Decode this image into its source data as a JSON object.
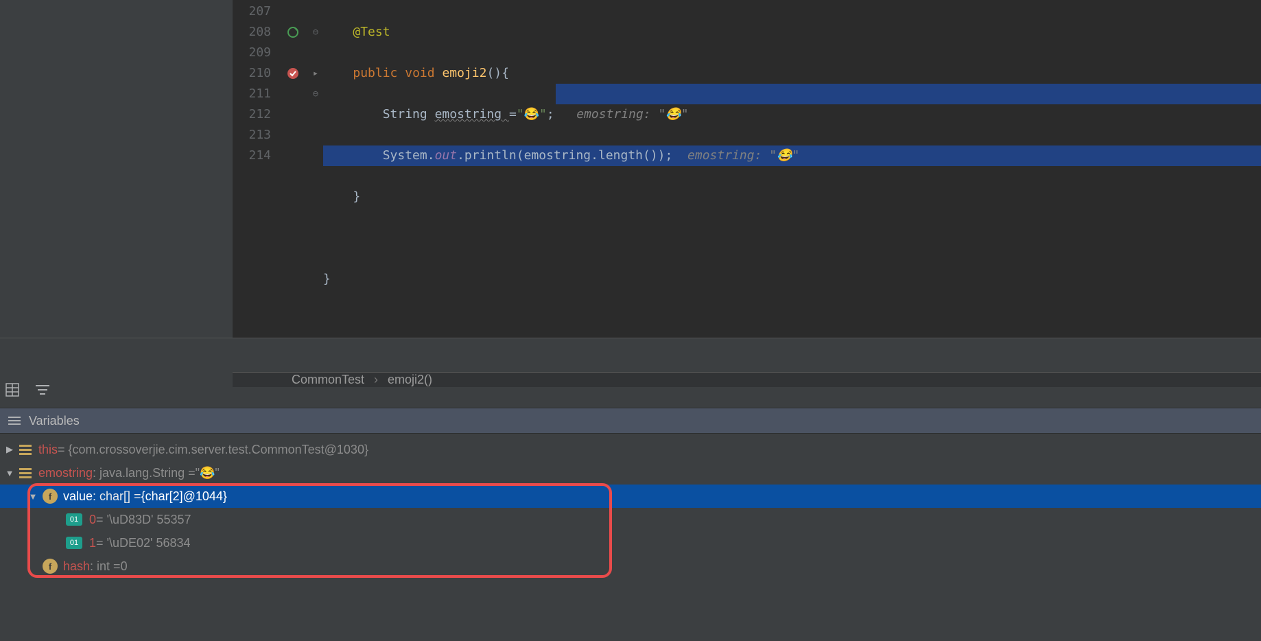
{
  "editor": {
    "lines": {
      "207": "207",
      "208": "208",
      "209": "209",
      "210": "210",
      "211": "211",
      "212": "212",
      "213": "213",
      "214": "214"
    },
    "code": {
      "annotation": "@Test",
      "kw_public": "public",
      "kw_void": "void",
      "method_name": "emoji2",
      "sig_tail": "(){",
      "type_string": "String ",
      "var_name": "emostring ",
      "assign": "=",
      "str_open": "\"",
      "emoji": "😂",
      "str_close": "\"",
      "semi": ";",
      "hint1_label": "emostring: ",
      "hint1_val": "\"😂\"",
      "sys": "System.",
      "out": "out",
      "println": ".println(emostring.length());",
      "hint2_label": "emostring: ",
      "hint2_val": "\"😂\"",
      "brace_close1": "}",
      "brace_close2": "}"
    }
  },
  "breadcrumb": {
    "a": "CommonTest",
    "b": "emoji2()"
  },
  "variables": {
    "header": "Variables",
    "this_label": "this",
    "this_val": " = {com.crossoverjie.cim.server.test.CommonTest@1030}",
    "emostring_label": "emostring",
    "emostring_type": ": java.lang.String  = ",
    "emostring_val": "\"😂\"",
    "value_label": "value",
    "value_type": ": char[]  = ",
    "value_val": "{char[2]@1044}",
    "idx0_label": "0",
    "idx0_val": " = '\\uD83D' 55357",
    "idx1_label": "1",
    "idx1_val": " = '\\uDE02' 56834",
    "hash_label": "hash",
    "hash_type": ": int  = ",
    "hash_val": "0",
    "badge_f": "f",
    "badge_01": "01"
  }
}
